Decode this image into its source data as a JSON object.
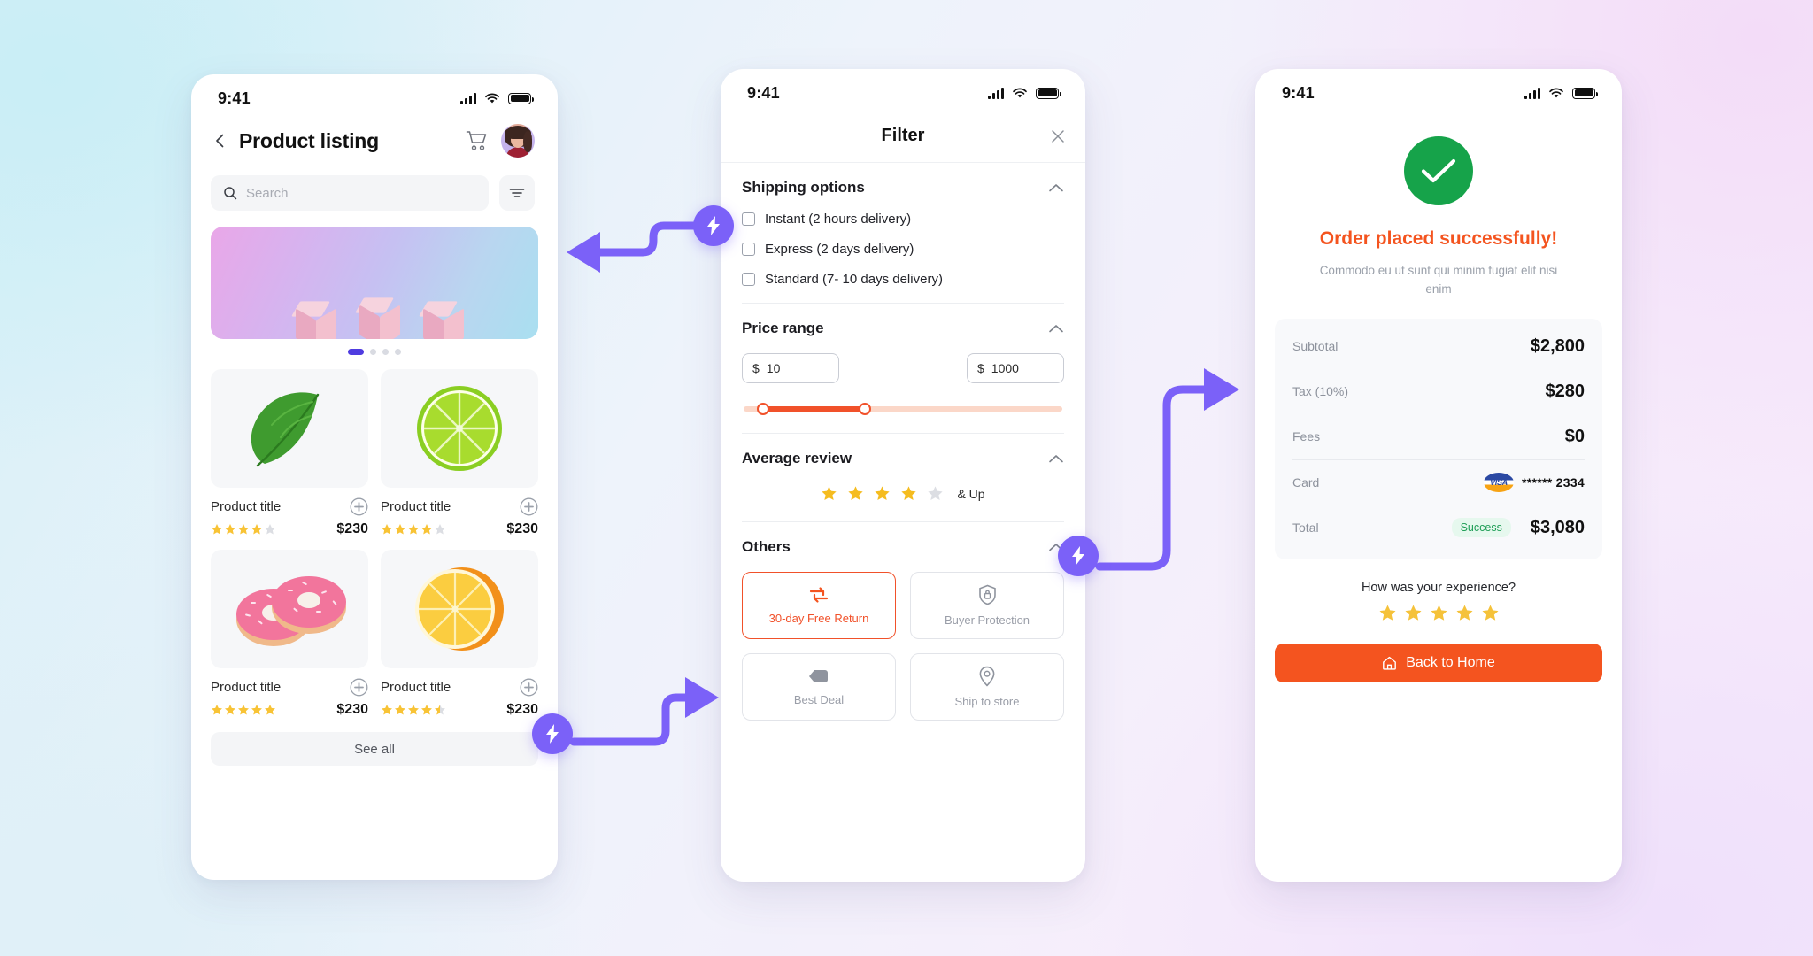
{
  "background": {
    "accent_purple": "#7b61f8",
    "accent_orange": "#f4541f",
    "success_green": "#16a34a"
  },
  "screens": {
    "product_listing": {
      "status_bar": {
        "time": "9:41",
        "signal_icon": "signal-bars-icon",
        "wifi_icon": "wifi-icon",
        "battery_icon": "battery-icon"
      },
      "back_icon": "chevron-left-icon",
      "title": "Product listing",
      "cart_icon": "shopping-cart-icon",
      "avatar_icon": "user-avatar",
      "search": {
        "placeholder": "Search",
        "icon": "search-icon"
      },
      "filter_icon": "filter-lines-icon",
      "carousel": {
        "active_dot": 0,
        "dot_count": 4
      },
      "products": [
        {
          "title": "Product title",
          "price": "$230",
          "rating": 4,
          "image": "basil-leaf-image",
          "add_icon": "plus-circle-icon"
        },
        {
          "title": "Product title",
          "price": "$230",
          "rating": 4,
          "image": "lime-slice-image",
          "add_icon": "plus-circle-icon"
        },
        {
          "title": "Product title",
          "price": "$230",
          "rating": 5,
          "image": "pink-donuts-image",
          "add_icon": "plus-circle-icon"
        },
        {
          "title": "Product title",
          "price": "$230",
          "rating": 4.5,
          "image": "orange-half-image",
          "add_icon": "plus-circle-icon"
        }
      ],
      "see_all_label": "See all"
    },
    "filter": {
      "status_bar": {
        "time": "9:41",
        "signal_icon": "signal-bars-icon",
        "wifi_icon": "wifi-icon",
        "battery_icon": "battery-icon"
      },
      "title": "Filter",
      "close_icon": "close-x-icon",
      "sections": {
        "shipping": {
          "title": "Shipping options",
          "collapse_icon": "chevron-up-icon",
          "options": [
            {
              "label": "Instant (2 hours delivery)",
              "checked": false
            },
            {
              "label": "Express (2 days delivery)",
              "checked": false
            },
            {
              "label": "Standard (7- 10 days delivery)",
              "checked": false
            }
          ]
        },
        "price_range": {
          "title": "Price range",
          "collapse_icon": "chevron-up-icon",
          "currency_symbol": "$",
          "min_value": "10",
          "max_value": "1000",
          "slider_min_pct": 6,
          "slider_max_pct": 38
        },
        "average_review": {
          "title": "Average review",
          "collapse_icon": "chevron-up-icon",
          "stars_filled": 4,
          "stars_total": 5,
          "suffix_label": "& Up"
        },
        "others": {
          "title": "Others",
          "collapse_icon": "chevron-up-icon",
          "cards": [
            {
              "label": "30-day Free Return",
              "icon": "return-arrows-icon",
              "selected": true
            },
            {
              "label": "Buyer Protection",
              "icon": "shield-lock-icon",
              "selected": false
            },
            {
              "label": "Best Deal",
              "icon": "price-tag-icon",
              "selected": false
            },
            {
              "label": "Ship to store",
              "icon": "map-pin-icon",
              "selected": false
            }
          ]
        }
      }
    },
    "order_success": {
      "status_bar": {
        "time": "9:41",
        "signal_icon": "signal-bars-icon",
        "wifi_icon": "wifi-icon",
        "battery_icon": "battery-icon"
      },
      "check_icon": "check-circle-icon",
      "title": "Order placed successfully!",
      "subtitle": "Commodo eu ut sunt qui minim fugiat elit nisi enim",
      "summary": [
        {
          "label": "Subtotal",
          "value": "$2,800"
        },
        {
          "label": "Tax (10%)",
          "value": "$280"
        },
        {
          "label": "Fees",
          "value": "$0"
        }
      ],
      "card_row": {
        "label": "Card",
        "brand_icon": "visa-card-icon",
        "brand_text": "VISA",
        "number": "****** 2334"
      },
      "total_row": {
        "label": "Total",
        "status_badge": "Success",
        "value": "$3,080"
      },
      "experience": {
        "question": "How was your experience?",
        "stars_filled": 5,
        "stars_total": 5
      },
      "home_button": {
        "label": "Back to Home",
        "icon": "home-icon"
      }
    }
  },
  "connectors": [
    {
      "name": "connector-listing-to-filter",
      "badge_icon": "lightning-bolt-icon",
      "direction": "left"
    },
    {
      "name": "connector-listing-to-others",
      "badge_icon": "lightning-bolt-icon",
      "direction": "right"
    },
    {
      "name": "connector-filter-to-success",
      "badge_icon": "lightning-bolt-icon",
      "direction": "right"
    }
  ]
}
